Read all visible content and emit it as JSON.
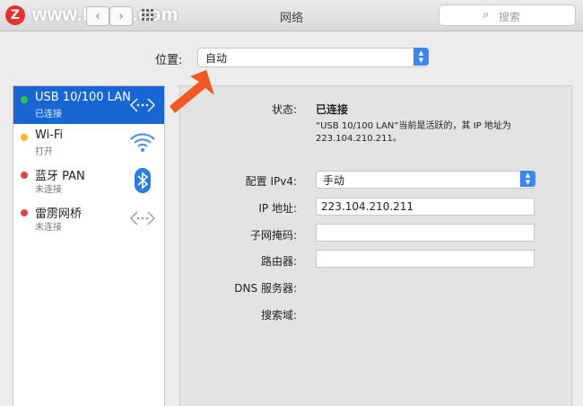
{
  "window": {
    "title": "网络"
  },
  "watermark": {
    "logo": "Z",
    "text": "www.MacZ.com"
  },
  "toolbar": {
    "back_icon": "chevron-left-icon",
    "forward_icon": "chevron-right-icon",
    "grid_icon": "grid-icon"
  },
  "search": {
    "placeholder": "搜索"
  },
  "location": {
    "label": "位置:",
    "value": "自动"
  },
  "services": [
    {
      "name": "USB 10/100 LAN",
      "status": "已连接",
      "dot": "#2fc742",
      "icon": "ethernet-icon",
      "selected": true
    },
    {
      "name": "Wi-Fi",
      "status": "打开",
      "dot": "#f4b829",
      "icon": "wifi-icon",
      "selected": false
    },
    {
      "name": "蓝牙 PAN",
      "status": "未连接",
      "dot": "#e0443e",
      "icon": "bluetooth-icon",
      "selected": false
    },
    {
      "name": "雷雳网桥",
      "status": "未连接",
      "dot": "#e0443e",
      "icon": "thunderbolt-bridge-icon",
      "selected": false
    }
  ],
  "detail": {
    "status_label": "状态:",
    "status_value": "已连接",
    "status_desc": "“USB 10/100 LAN”当前是活跃的，其 IP 地址为 223.104.210.211。",
    "config_label": "配置 IPv4:",
    "config_value": "手动",
    "ip_label": "IP 地址:",
    "ip_value": "223.104.210.211",
    "subnet_label": "子网掩码:",
    "subnet_value": "",
    "router_label": "路由器:",
    "router_value": "",
    "dns_label": "DNS 服务器:",
    "search_domain_label": "搜索域:"
  },
  "colors": {
    "accent": "#1866d3",
    "stepper": "#3d86f0",
    "annotation_arrow": "#f05a22"
  }
}
